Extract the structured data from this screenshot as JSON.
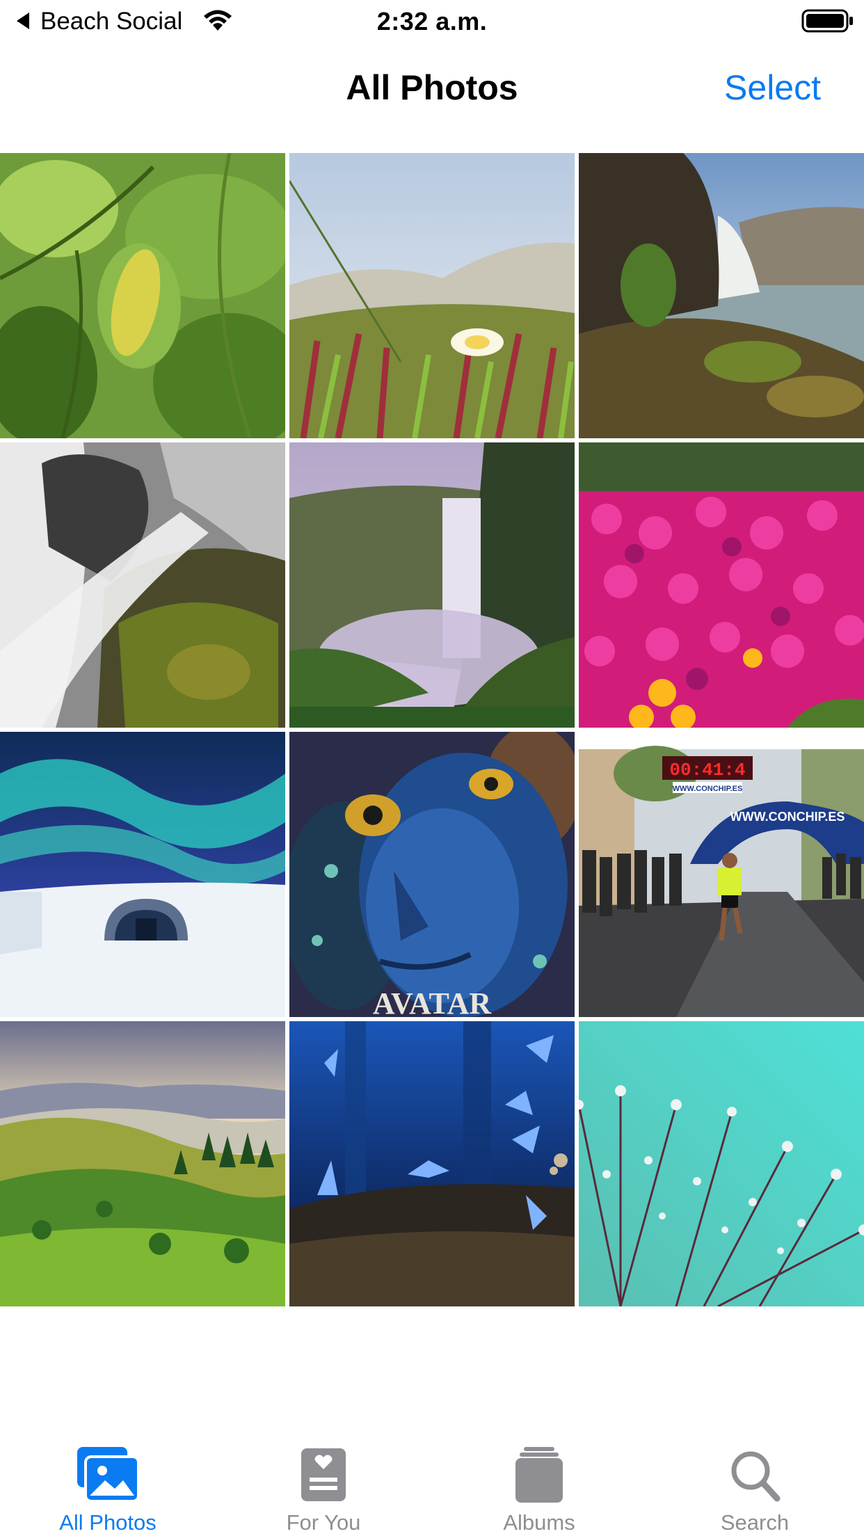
{
  "status_bar": {
    "app_name": "Beach Social",
    "time": "2:32 a.m.",
    "icons": [
      "back-arrow-icon",
      "wifi-icon",
      "battery-icon"
    ]
  },
  "nav": {
    "title": "All Photos",
    "select_label": "Select"
  },
  "colors": {
    "accent": "#0a7bf1",
    "tab_inactive": "#8e8e93",
    "background": "#ffffff"
  },
  "photos": [
    {
      "subject": "leaves"
    },
    {
      "subject": "dune-flower"
    },
    {
      "subject": "coastal-waterfall"
    },
    {
      "subject": "cascade-rocks"
    },
    {
      "subject": "misty-waterfall"
    },
    {
      "subject": "magenta-flowers"
    },
    {
      "subject": "aurora-ice-cave"
    },
    {
      "subject": "avatar-poster",
      "caption": "AVATAR"
    },
    {
      "subject": "street-race",
      "banner": "WWW.CONCHIP.ES",
      "clock": "00:41:4",
      "sub_banner": "WWW.CONCHIP.ES"
    },
    {
      "subject": "green-hills"
    },
    {
      "subject": "blue-butterflies"
    },
    {
      "subject": "dewdrop-dandelion"
    }
  ],
  "tabs": [
    {
      "label": "All Photos",
      "icon": "photos-icon",
      "active": true
    },
    {
      "label": "For You",
      "icon": "for-you-icon",
      "active": false
    },
    {
      "label": "Albums",
      "icon": "albums-icon",
      "active": false
    },
    {
      "label": "Search",
      "icon": "search-icon",
      "active": false
    }
  ]
}
